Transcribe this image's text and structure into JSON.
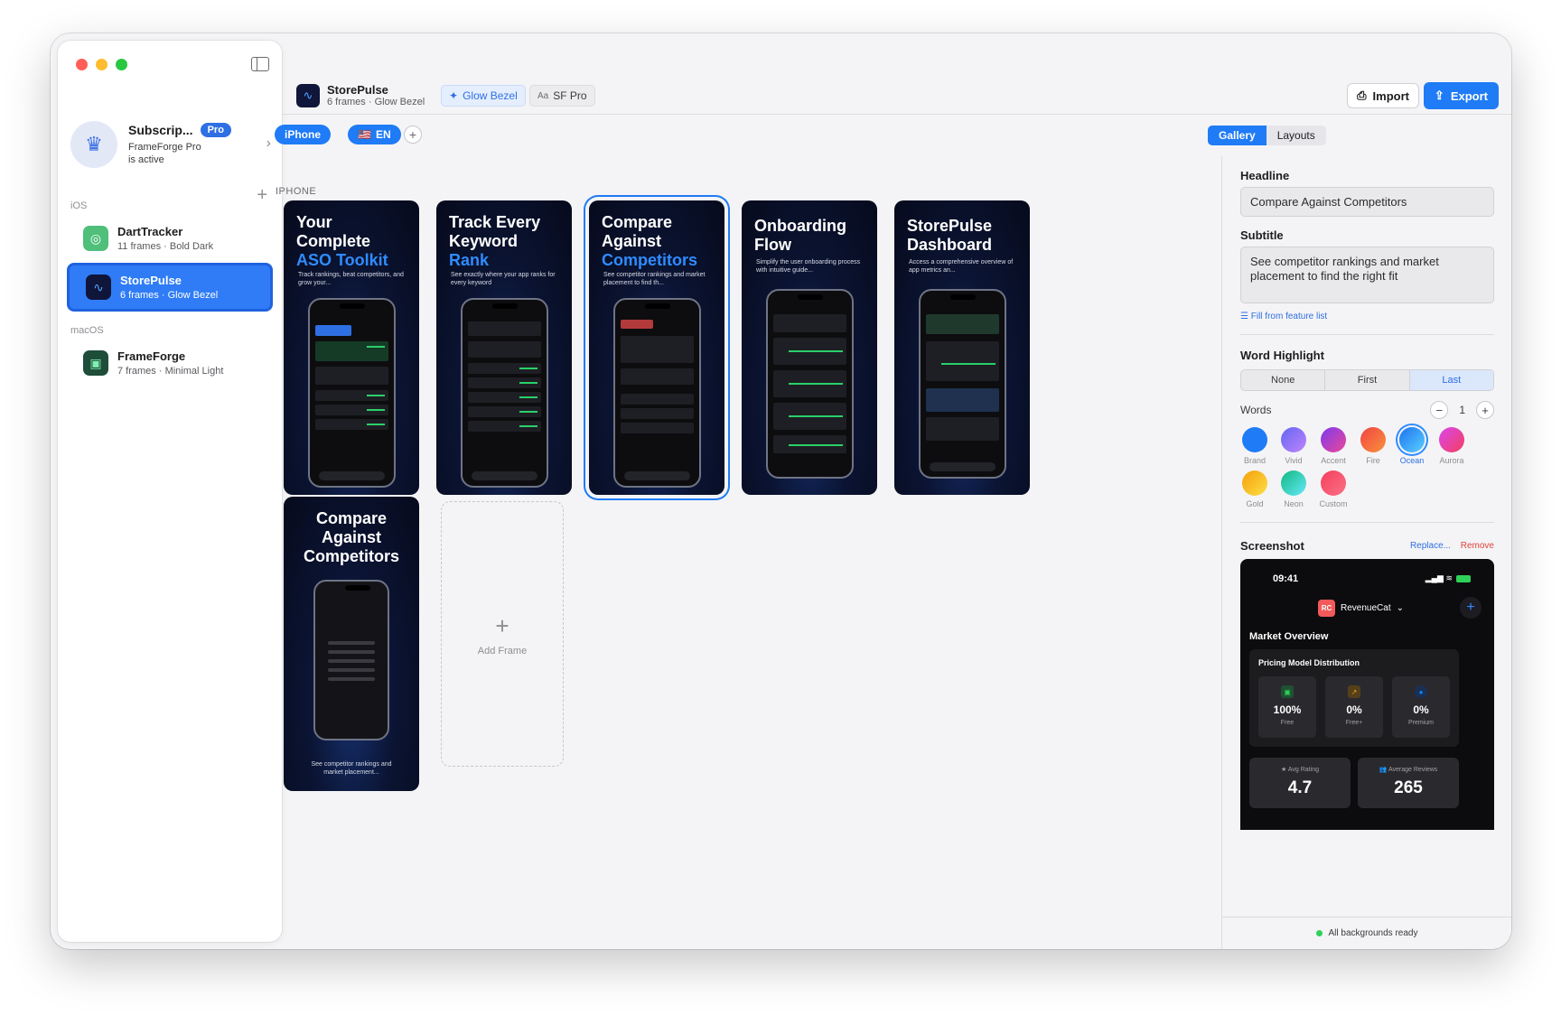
{
  "sidebar": {
    "subscription": {
      "title": "Subscrip...",
      "badge": "Pro",
      "line1": "FrameForge Pro",
      "line2": "is active"
    },
    "sections": {
      "ios": "iOS",
      "macos": "macOS"
    },
    "projects": [
      {
        "name": "DartTracker",
        "meta": "11 frames · Bold Dark"
      },
      {
        "name": "StorePulse",
        "meta": "6 frames · Glow Bezel"
      },
      {
        "name": "FrameForge",
        "meta": "7 frames · Minimal Light"
      }
    ]
  },
  "toolbar": {
    "app_name": "StorePulse",
    "app_meta": "6 frames · Glow Bezel",
    "style_chip": "Glow Bezel",
    "font_chip_prefix": "Aa",
    "font_chip": "SF Pro",
    "import_label": "Import",
    "export_label": "Export"
  },
  "subbar": {
    "device": "iPhone",
    "flag": "🇺🇸",
    "language": "EN",
    "view_tabs": [
      "Gallery",
      "Layouts"
    ],
    "active_view": "Gallery"
  },
  "canvas": {
    "section_label": "IPHONE",
    "frames": [
      {
        "line1": "Your",
        "line2": "Complete",
        "highlight": "ASO Toolkit",
        "sub": "Track rankings, beat competitors, and grow your..."
      },
      {
        "line1": "Track Every",
        "line2": "Keyword",
        "highlight": "Rank",
        "sub": "See exactly where your app ranks for every keyword"
      },
      {
        "line1": "Compare",
        "line2": "Against",
        "highlight": "Competitors",
        "sub": "See competitor rankings and market placement to find th..."
      },
      {
        "line1": "Onboarding",
        "line2": "Flow",
        "highlight": "",
        "sub": "Simplify the user onboarding process with intuitive guide..."
      },
      {
        "line1": "StorePulse",
        "line2": "Dashboard",
        "highlight": "",
        "sub": "Access a comprehensive overview of app metrics an..."
      },
      {
        "line1": "Compare",
        "line2": "Against",
        "line3": "Competitors",
        "sub": "See competitor rankings and market placement..."
      }
    ],
    "add_frame_label": "Add Frame"
  },
  "inspector": {
    "headline_label": "Headline",
    "headline_value": "Compare Against Competitors",
    "subtitle_label": "Subtitle",
    "subtitle_value": "See competitor rankings and market placement to find the right fit",
    "fill_link": "Fill from feature list",
    "word_highlight_label": "Word Highlight",
    "highlight_options": [
      "None",
      "First",
      "Last"
    ],
    "highlight_selected": "Last",
    "words_label": "Words",
    "words_count": "1",
    "swatches": [
      {
        "name": "Brand",
        "color": "#1f7bf6"
      },
      {
        "name": "Vivid",
        "color": "#8b5cf6"
      },
      {
        "name": "Accent",
        "color": "#a855f7"
      },
      {
        "name": "Fire",
        "color": "#f97316"
      },
      {
        "name": "Ocean",
        "color": "#38bdf8"
      },
      {
        "name": "Aurora",
        "color": "#e0559a"
      },
      {
        "name": "Gold",
        "color": "#fbbf24"
      },
      {
        "name": "Neon",
        "color": "#34d399"
      },
      {
        "name": "Custom",
        "color": "#f43f5e"
      }
    ],
    "selected_swatch": "Ocean",
    "screenshot_label": "Screenshot",
    "replace_label": "Replace...",
    "remove_label": "Remove",
    "preview": {
      "time": "09:41",
      "brand": "RevenueCat",
      "brand_logo": "RC",
      "section": "Market Overview",
      "card_title": "Pricing Model Distribution",
      "pricing": [
        {
          "pct": "100%",
          "label": "Free",
          "color": "#30d158"
        },
        {
          "pct": "0%",
          "label": "Free+",
          "color": "#ff9f0a"
        },
        {
          "pct": "0%",
          "label": "Premium",
          "color": "#0a84ff"
        }
      ],
      "stats": [
        {
          "label": "Avg Rating",
          "value": "4.7"
        },
        {
          "label": "Average Reviews",
          "value": "265"
        }
      ]
    },
    "footer_status": "All backgrounds ready"
  }
}
